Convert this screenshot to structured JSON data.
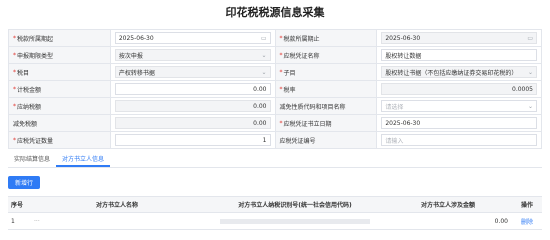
{
  "page_title": "印花税税源信息采集",
  "form_rows": [
    [
      {
        "label": "税款所属期起",
        "required": true,
        "value": "2025-06-30",
        "placeholder": "",
        "style": "edit",
        "align": "left",
        "suffix": "▭"
      },
      {
        "label": "税款所属期止",
        "required": true,
        "value": "2025-06-30",
        "placeholder": "",
        "style": "readonly",
        "align": "left",
        "suffix": "▭"
      }
    ],
    [
      {
        "label": "申报期限类型",
        "required": true,
        "value": "按次申报",
        "placeholder": "",
        "style": "readonly",
        "align": "left",
        "suffix": "⌄"
      },
      {
        "label": "应税凭证名称",
        "required": true,
        "value": "股权转让数据",
        "placeholder": "",
        "style": "edit",
        "align": "left",
        "suffix": ""
      }
    ],
    [
      {
        "label": "税目",
        "required": true,
        "value": "产权转移书据",
        "placeholder": "",
        "style": "readonly",
        "align": "left",
        "suffix": "⌄"
      },
      {
        "label": "子目",
        "required": true,
        "value": "股权转让书据（不包括应缴纳证券交易印花税的）",
        "placeholder": "",
        "style": "readonly",
        "align": "left",
        "suffix": "⌄"
      }
    ],
    [
      {
        "label": "计税金额",
        "required": true,
        "value": "0.00",
        "placeholder": "",
        "style": "edit",
        "align": "right",
        "suffix": ""
      },
      {
        "label": "税率",
        "required": true,
        "value": "0.0005",
        "placeholder": "",
        "style": "readonly",
        "align": "right",
        "suffix": ""
      }
    ],
    [
      {
        "label": "应纳税额",
        "required": true,
        "value": "0.00",
        "placeholder": "",
        "style": "readonly",
        "align": "right",
        "suffix": ""
      },
      {
        "label": "减免性质代码和项目名称",
        "required": false,
        "value": "",
        "placeholder": "请选择",
        "style": "edit",
        "align": "left",
        "suffix": "⌄"
      }
    ],
    [
      {
        "label": "减免税额",
        "required": false,
        "value": "0.00",
        "placeholder": "",
        "style": "readonly",
        "align": "right",
        "suffix": ""
      },
      {
        "label": "应税凭证书立日期",
        "required": true,
        "value": "2025-06-30",
        "placeholder": "",
        "style": "edit",
        "align": "left",
        "suffix": ""
      }
    ],
    [
      {
        "label": "应税凭证数量",
        "required": true,
        "value": "1",
        "placeholder": "",
        "style": "edit",
        "align": "right",
        "suffix": ""
      },
      {
        "label": "应税凭证编号",
        "required": false,
        "value": "",
        "placeholder": "请输入",
        "style": "edit",
        "align": "left",
        "suffix": ""
      }
    ]
  ],
  "tabs": [
    "实际结算信息",
    "对方书立人信息"
  ],
  "active_tab": 1,
  "add_button": "新增行",
  "table": {
    "headers": [
      "序号",
      "对方书立人名称",
      "对方书立人纳税识别号(统一社会信用代码)",
      "对方书立人涉及金额",
      "操作"
    ],
    "rows": [
      {
        "index": "1",
        "name": "···",
        "amount": "0.00",
        "action": "删除"
      }
    ]
  },
  "colors": {
    "accent": "#2f7bf5",
    "required": "#e0322c",
    "label_bg": "#f5f6f8",
    "border": "#e3e6ec"
  }
}
